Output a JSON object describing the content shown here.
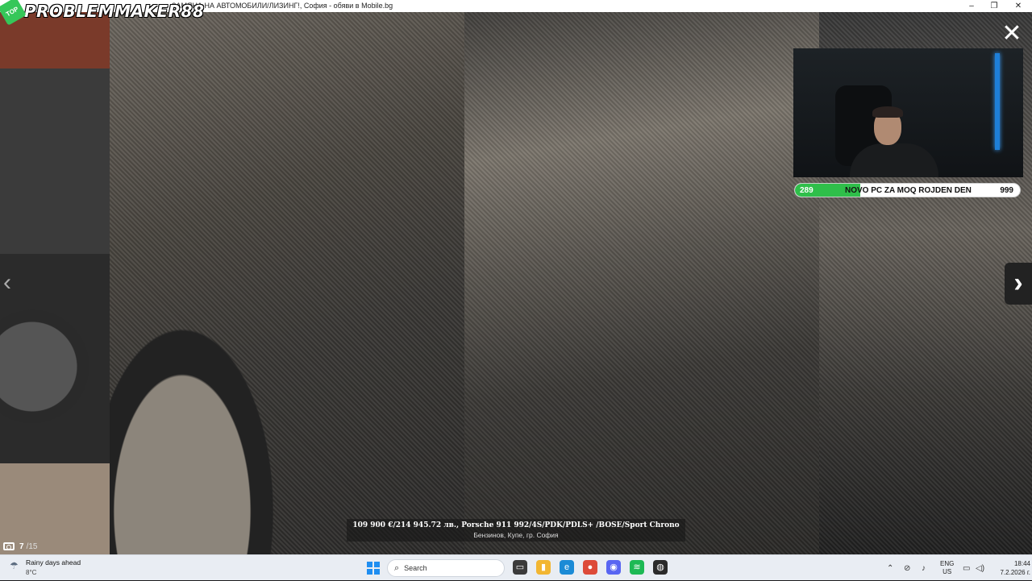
{
  "window": {
    "title": "ЗАМЯНА НА АВТОМОБИЛИ/ЛИЗИНГ!, София - обяви в Mobile.bg",
    "minimize": "–",
    "maximize": "❐",
    "close": "✕"
  },
  "stream": {
    "channel_name": "PROBLEMMAKER88",
    "badge_text": "TOP"
  },
  "gallery": {
    "close_glyph": "✕",
    "prev_glyph": "‹",
    "next_glyph": "›",
    "counter_current": "7",
    "counter_total": "/15",
    "caption_title": "109 900 €/214 945.72 лв., Porsche 911 992/4S/PDK/PDLS+ /BOSE/Sport Chrono",
    "caption_subtitle": "Бензинов, Купе, гр. София"
  },
  "goal": {
    "current": "289",
    "label": "NOVO PC ZA MOQ ROJDEN DEN",
    "target": "999",
    "progress_fraction": 0.289,
    "fill_color": "#2fbf4a"
  },
  "taskbar": {
    "weather_line1": "Rainy days ahead",
    "weather_line2": "8°C",
    "search_label": "Search",
    "lang_line1": "ENG",
    "lang_line2": "US",
    "time": "18:44",
    "date": "7.2.2026 г.",
    "apps": [
      {
        "name": "task-view-icon",
        "glyph": "▭",
        "color": "#3b3b3b"
      },
      {
        "name": "file-explorer-icon",
        "glyph": "▮",
        "color": "#f2b632"
      },
      {
        "name": "edge-icon",
        "glyph": "e",
        "color": "#1b8bd6"
      },
      {
        "name": "chrome-icon",
        "glyph": "●",
        "color": "#dd4b39"
      },
      {
        "name": "discord-icon",
        "glyph": "◉",
        "color": "#5865f2"
      },
      {
        "name": "spotify-icon",
        "glyph": "≋",
        "color": "#1db954"
      },
      {
        "name": "obs-icon",
        "glyph": "◍",
        "color": "#2b2b2b"
      }
    ]
  }
}
